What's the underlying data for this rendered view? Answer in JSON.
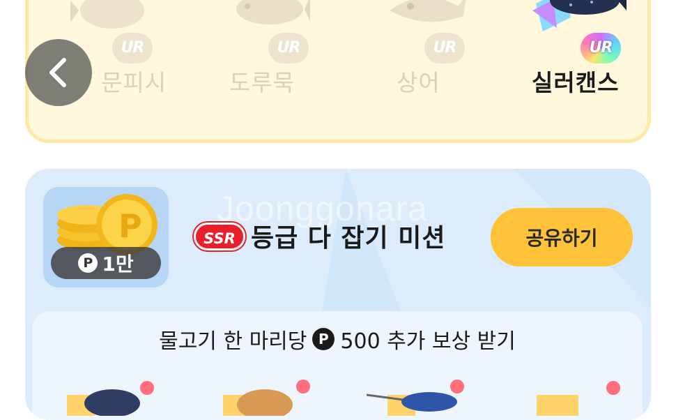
{
  "collection": {
    "fish": [
      {
        "name": "문피시",
        "badge": "UR",
        "collected": false
      },
      {
        "name": "도루묵",
        "badge": "UR",
        "collected": false
      },
      {
        "name": "상어",
        "badge": "UR",
        "collected": false
      },
      {
        "name": "실러캔스",
        "badge": "UR",
        "collected": true
      }
    ]
  },
  "mission": {
    "watermark": "Joonggonara",
    "reward_label": "1만",
    "point_symbol": "P",
    "grade_badge": "SSR",
    "title": "등급 다 잡기 미션",
    "share_label": "공유하기",
    "bonus_prefix": "물고기 한 마리당",
    "bonus_suffix": "500 추가 보상 받기"
  },
  "colors": {
    "top_card_bg": "#fff8dc",
    "mission_card_bg": "#dcecfb",
    "share_button": "#ffc238",
    "ssr_badge": "#e8202a"
  }
}
